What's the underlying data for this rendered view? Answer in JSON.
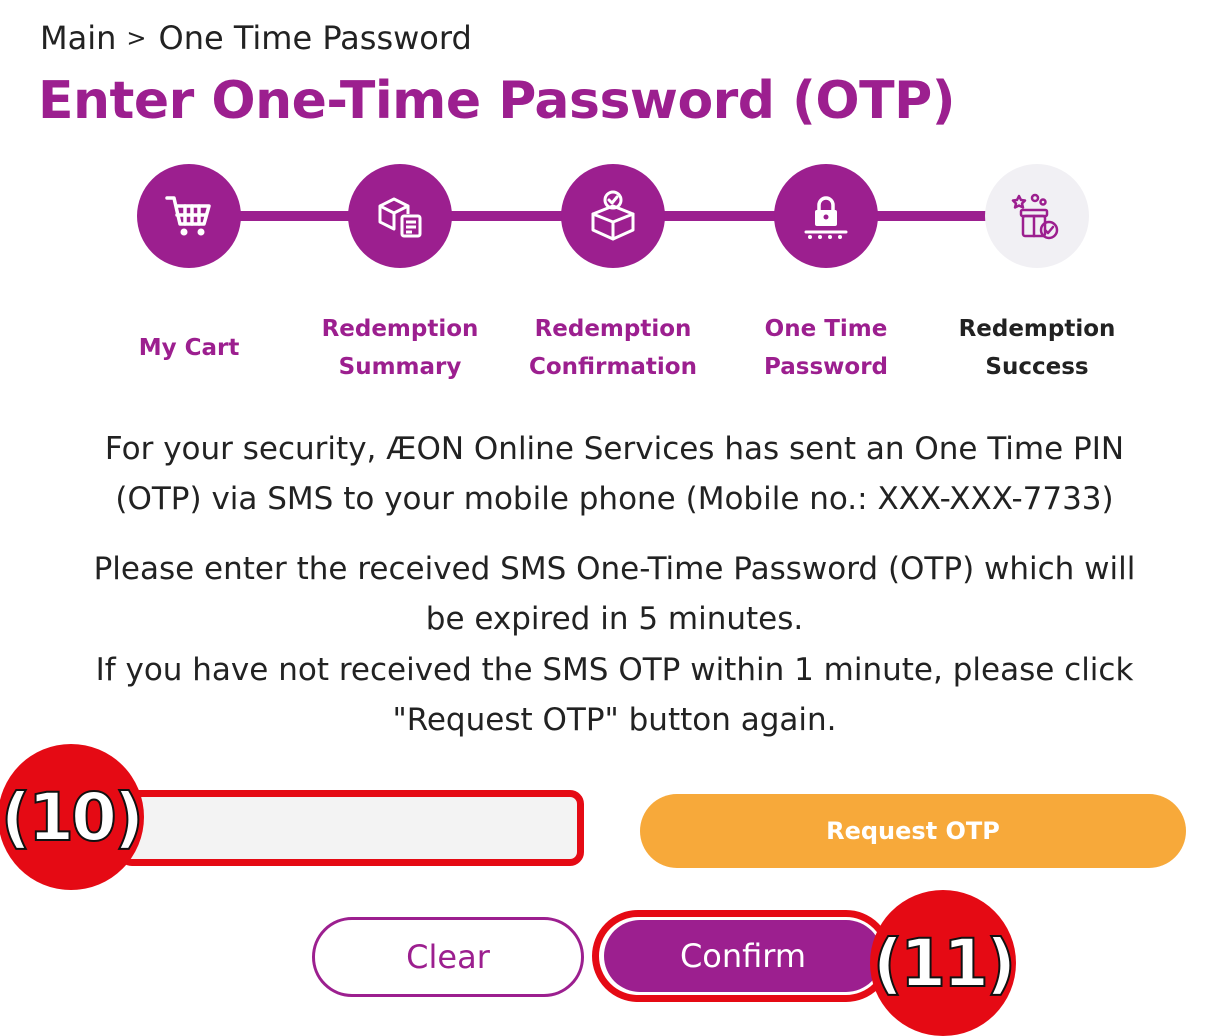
{
  "breadcrumb": {
    "home": "Main",
    "separator": ">",
    "current": "One Time Password"
  },
  "page": {
    "title": "Enter One-Time Password (OTP)"
  },
  "stepper": {
    "active_color": "#9c1f8f",
    "inactive_color": "#f1f0f4",
    "steps": [
      {
        "icon": "cart-icon",
        "label_line1": "My Cart",
        "label_line2": "",
        "status": "completed"
      },
      {
        "icon": "packages-summary-icon",
        "label_line1": "Redemption",
        "label_line2": "Summary",
        "status": "completed"
      },
      {
        "icon": "box-check-icon",
        "label_line1": "Redemption",
        "label_line2": "Confirmation",
        "status": "completed"
      },
      {
        "icon": "lock-password-icon",
        "label_line1": "One Time",
        "label_line2": "Password",
        "status": "completed"
      },
      {
        "icon": "gift-success-icon",
        "label_line1": "Redemption",
        "label_line2": "Success",
        "status": "current"
      }
    ]
  },
  "instructions": {
    "security_line1": "For your security, ÆON Online Services has sent an One Time PIN",
    "security_line2": "(OTP) via SMS to your mobile phone (Mobile no.: XXX-XXX-7733)",
    "expiry_line1": "Please enter the received SMS One-Time Password (OTP) which will",
    "expiry_line2": "be expired in 5 minutes.",
    "resend_line1": "If you have not received the SMS OTP within 1 minute, please click",
    "resend_line2": "\"Request OTP\" button again."
  },
  "form": {
    "otp_value": "",
    "otp_placeholder": "",
    "request_otp_label": "Request OTP",
    "clear_label": "Clear",
    "confirm_label": "Confirm"
  },
  "annotations": {
    "otp_marker": "(10)",
    "confirm_marker": "(11)",
    "highlight_color": "#e50a14"
  },
  "colors": {
    "brand": "#9c1f8f",
    "accent": "#f7a93a"
  }
}
